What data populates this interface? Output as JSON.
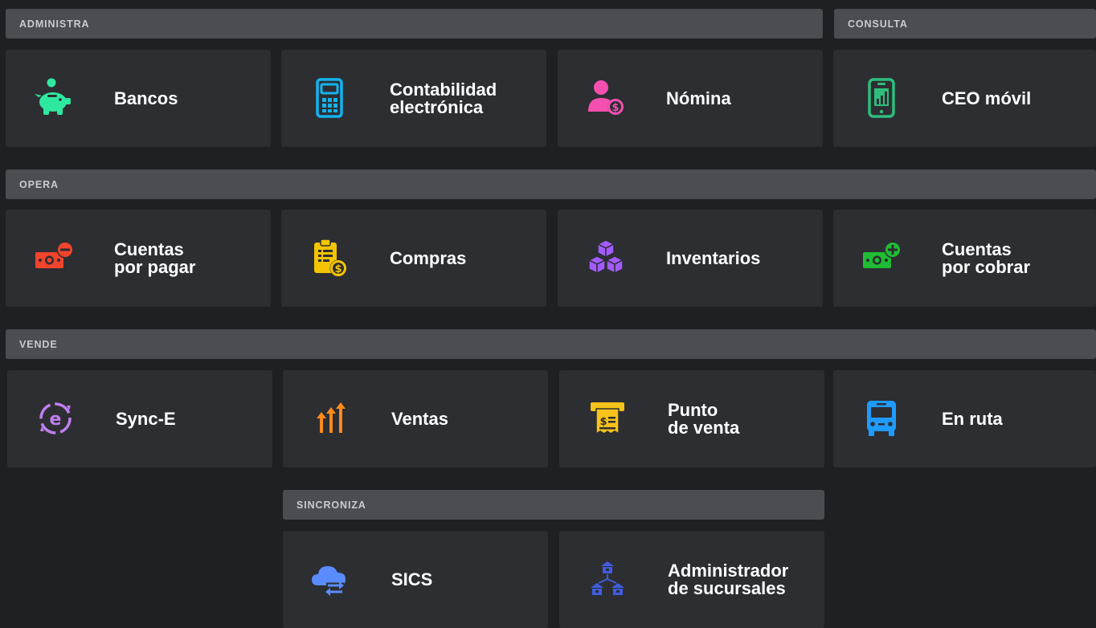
{
  "sections": {
    "administra": "ADMINISTRA",
    "consulta": "CONSULTA",
    "opera": "OPERA",
    "vende": "VENDE",
    "sincroniza": "SINCRONIZA"
  },
  "tiles": {
    "bancos": {
      "line1": "Bancos",
      "line2": "",
      "icon": "piggy-bank-icon",
      "color": "#2ee8a0"
    },
    "contabilidad": {
      "line1": "Contabilidad",
      "line2": "electrónica",
      "icon": "calculator-icon",
      "color": "#12b4f0"
    },
    "nomina": {
      "line1": "Nómina",
      "line2": "",
      "icon": "user-dollar-icon",
      "color": "#f54fb0"
    },
    "ceo": {
      "line1": "CEO móvil",
      "line2": "",
      "icon": "mobile-chart-icon",
      "color": "#2ebd7c"
    },
    "cuentas_pagar": {
      "line1": "Cuentas",
      "line2": "por pagar",
      "icon": "money-minus-icon",
      "color": "#f0442c"
    },
    "compras": {
      "line1": "Compras",
      "line2": "",
      "icon": "clipboard-dollar-icon",
      "color": "#f5c400"
    },
    "inventarios": {
      "line1": "Inventarios",
      "line2": "",
      "icon": "cubes-icon",
      "color": "#a25bff"
    },
    "cuentas_cobrar": {
      "line1": "Cuentas",
      "line2": "por cobrar",
      "icon": "money-plus-icon",
      "color": "#1fbc34"
    },
    "sync": {
      "line1": "Sync-E",
      "line2": "",
      "icon": "sync-e-icon",
      "color": "#c07ff0"
    },
    "ventas": {
      "line1": "Ventas",
      "line2": "",
      "icon": "arrows-up-icon",
      "color": "#ff8a1a"
    },
    "punto_venta": {
      "line1": "Punto",
      "line2": "de venta",
      "icon": "receipt-printer-icon",
      "color": "#f7c21a"
    },
    "en_ruta": {
      "line1": "En ruta",
      "line2": "",
      "icon": "bus-icon",
      "color": "#1f9bff"
    },
    "sics": {
      "line1": "SICS",
      "line2": "",
      "icon": "cloud-sync-icon",
      "color": "#5a8bff"
    },
    "admin_sucursales": {
      "line1": "Administrador",
      "line2": "de sucursales",
      "icon": "branches-icon",
      "color": "#3e5de0"
    }
  }
}
